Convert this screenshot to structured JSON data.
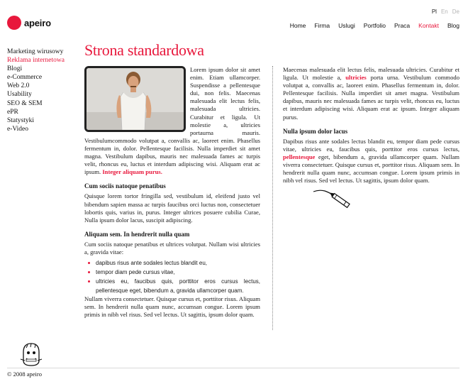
{
  "languages": [
    {
      "label": "Pl",
      "active": true
    },
    {
      "label": "En",
      "active": false
    },
    {
      "label": "De",
      "active": false
    }
  ],
  "logo": {
    "text": "apeiro",
    "color": "#e8183c"
  },
  "nav": [
    "Home",
    "Firma",
    "Uslugi",
    "Portfolio",
    "Praca",
    "Kontakt",
    "Blog"
  ],
  "nav_active": "Kontakt",
  "sidebar": [
    "Marketing wirusowy",
    "Reklama internetowa",
    "Blogi",
    "e-Commerce",
    "Web 2.0",
    "Usability",
    "SEO & SEM",
    "ePR",
    "Statystyki",
    "e-Video"
  ],
  "sidebar_active": "Reklama internetowa",
  "page_title": "Strona standardowa",
  "left": {
    "intro": "Lorem ipsum dolor sit amet enim. Etiam ullamcorper. Suspendisse a pellentesque dui, non felis. Maecenas malesuada elit lectus felis, malesuada ultricies. Curabitur et ligula. Ut molestie a, ultricies portaurna mauris. Vestibulumcommodo volutpat a, convallis ac, laoreet enim. Phasellus fermentum in, dolor. Pellentesque facilisis. Nulla imperdiet sit amet magna. Vestibulum dapibus, mauris nec malesuada fames ac turpis velit, rhoncus eu, luctus et interdum adipiscing wisi. Aliquam erat ac ipsum.",
    "intro_highlight": "Integer aliquam purus.",
    "h2": "Cum sociis natoque penatibus",
    "p2": "Quisque lorem tortor fringilla sed, vestibulum id, eleifend justo vel bibendum sapien massa ac turpis faucibus orci luctus non, consectetuer lobortis quis, varius in, purus. Integer ultrices posuere cubilia Curae, Nulla ipsum dolor lacus, suscipit adipiscing.",
    "h3": "Aliquam sem. In hendrerit nulla quam",
    "p3": "Cum sociis natoque penatibus et ultrices volutpat. Nullam wisi ultricies a, gravida vitae:",
    "bullets": [
      "dapibus risus ante sodales lectus blandit eu,",
      "tempor diam pede cursus vitae,",
      "ultricies eu, faucibus quis, porttitor eros cursus lectus, pellentesque eget, bibendum a, gravida ullamcorper quam."
    ],
    "p4": "Nullam viverra consectetuer. Quisque cursus et, porttitor risus. Aliquam sem. In hendrerit nulla quam nunc, accumsan congue. Lorem ipsum primis in nibh vel risus. Sed vel lectus. Ut sagittis, ipsum dolor quam."
  },
  "right": {
    "p1_a": "Maecenas malesuada elit lectus felis, malesuada ultricies. Curabitur et ligula. Ut molestie a,",
    "p1_highlight": "ultricies",
    "p1_b": "porta urna. Vestibulum commodo volutpat a, convallis ac, laoreet enim. Phasellus fermentum in, dolor. Pellentesque facilisis. Nulla imperdiet sit amet magna. Vestibulum dapibus, mauris nec malesuada fames ac turpis velit, rhoncus eu, luctus et interdum adipiscing wisi. Aliquam erat ac ipsum. Integer aliquam purus.",
    "h2": "Nulla ipsum dolor lacus",
    "p2_a": "Dapibus risus ante sodales lectus blandit eu, tempor diam pede cursus vitae, ultricies eu, faucibus quis, porttitor eros cursus lectus,",
    "p2_highlight": "pellentesque",
    "p2_b": "eget, bibendum a, gravida ullamcorper quam. Nullam viverra consectetuer. Quisque cursus et, porttitor risus. Aliquam sem. In hendrerit nulla quam nunc, accumsan congue. Lorem ipsum primis in nibh vel risus. Sed vel lectus. Ut sagittis, ipsum dolor quam."
  },
  "footer": "© 2008 apeiro",
  "icons": {
    "photo": "photo-man-in-tank-top",
    "pencil": "pencil-icon",
    "mascot": "mascot-icon"
  }
}
